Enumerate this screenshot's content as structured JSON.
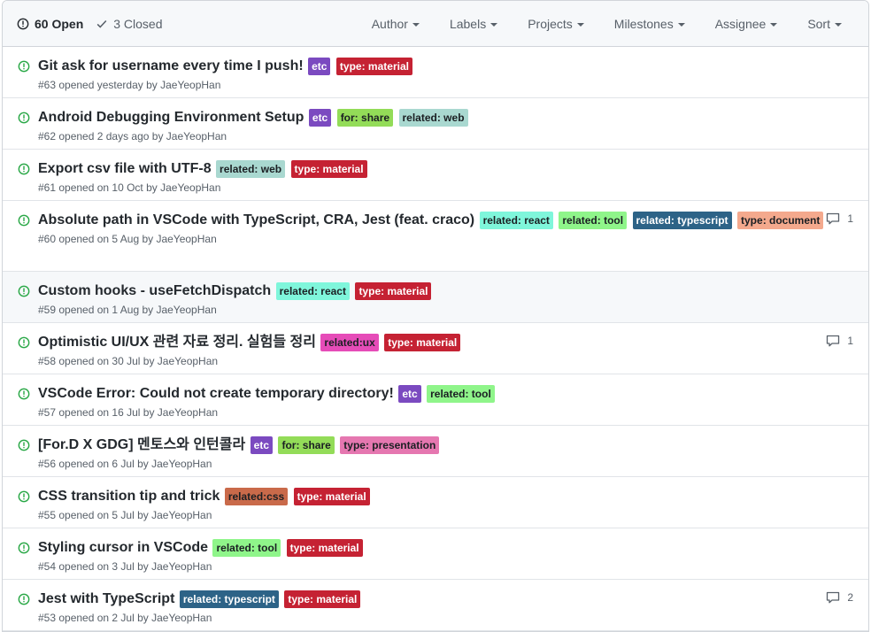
{
  "header": {
    "open_label": "60 Open",
    "closed_label": "3 Closed",
    "filters": [
      "Author",
      "Labels",
      "Projects",
      "Milestones",
      "Assignee",
      "Sort"
    ]
  },
  "colors": {
    "open_icon": "#28a745",
    "label_colors": {
      "etc": [
        "#7b4ac0",
        "#ffffff"
      ],
      "type: material": [
        "#c52233",
        "#ffffff"
      ],
      "for: share": [
        "#93dc58",
        "#1b1f23"
      ],
      "related: web": [
        "#a9d8d0",
        "#1b1f23"
      ],
      "related: react": [
        "#7ff6db",
        "#1b1f23"
      ],
      "related: tool": [
        "#8ff58a",
        "#1b1f23"
      ],
      "related: typescript": [
        "#2d6387",
        "#ffffff"
      ],
      "type: document": [
        "#f4a98d",
        "#1b1f23"
      ],
      "related:ux": [
        "#e64cb8",
        "#1b1f23"
      ],
      "type: presentation": [
        "#e577b0",
        "#1b1f23"
      ],
      "related:css": [
        "#c96a4a",
        "#1b1f23"
      ]
    }
  },
  "issues": [
    {
      "title": "Git ask for username every time I push!",
      "labels": [
        "etc",
        "type: material"
      ],
      "meta": "#63 opened yesterday by JaeYeopHan",
      "comments": ""
    },
    {
      "title": "Android Debugging Environment Setup",
      "labels": [
        "etc",
        "for: share",
        "related: web"
      ],
      "meta": "#62 opened 2 days ago by JaeYeopHan",
      "comments": ""
    },
    {
      "title": "Export csv file with UTF-8",
      "labels": [
        "related: web",
        "type: material"
      ],
      "meta": "#61 opened on 10 Oct by JaeYeopHan",
      "comments": ""
    },
    {
      "title": "Absolute path in VSCode with TypeScript, CRA, Jest (feat. craco)",
      "labels": [
        "related: react",
        "related: tool",
        "related: typescript",
        "type: document"
      ],
      "meta": "#60 opened on 5 Aug by JaeYeopHan",
      "comments": "1"
    },
    {
      "title": "Custom hooks - useFetchDispatch",
      "labels": [
        "related: react",
        "type: material"
      ],
      "meta": "#59 opened on 1 Aug by JaeYeopHan",
      "comments": "",
      "highlight": true
    },
    {
      "title": "Optimistic UI/UX 관련 자료 정리. 실험들 정리",
      "labels": [
        "related:ux",
        "type: material"
      ],
      "meta": "#58 opened on 30 Jul by JaeYeopHan",
      "comments": "1"
    },
    {
      "title": "VSCode Error: Could not create temporary directory!",
      "labels": [
        "etc",
        "related: tool"
      ],
      "meta": "#57 opened on 16 Jul by JaeYeopHan",
      "comments": ""
    },
    {
      "title": "[For.D X GDG] 멘토스와 인턴콜라",
      "labels": [
        "etc",
        "for: share",
        "type: presentation"
      ],
      "meta": "#56 opened on 6 Jul by JaeYeopHan",
      "comments": ""
    },
    {
      "title": "CSS transition tip and trick",
      "labels": [
        "related:css",
        "type: material"
      ],
      "meta": "#55 opened on 5 Jul by JaeYeopHan",
      "comments": ""
    },
    {
      "title": "Styling cursor in VSCode",
      "labels": [
        "related: tool",
        "type: material"
      ],
      "meta": "#54 opened on 3 Jul by JaeYeopHan",
      "comments": ""
    },
    {
      "title": "Jest with TypeScript",
      "labels": [
        "related: typescript",
        "type: material"
      ],
      "meta": "#53 opened on 2 Jul by JaeYeopHan",
      "comments": "2"
    }
  ]
}
